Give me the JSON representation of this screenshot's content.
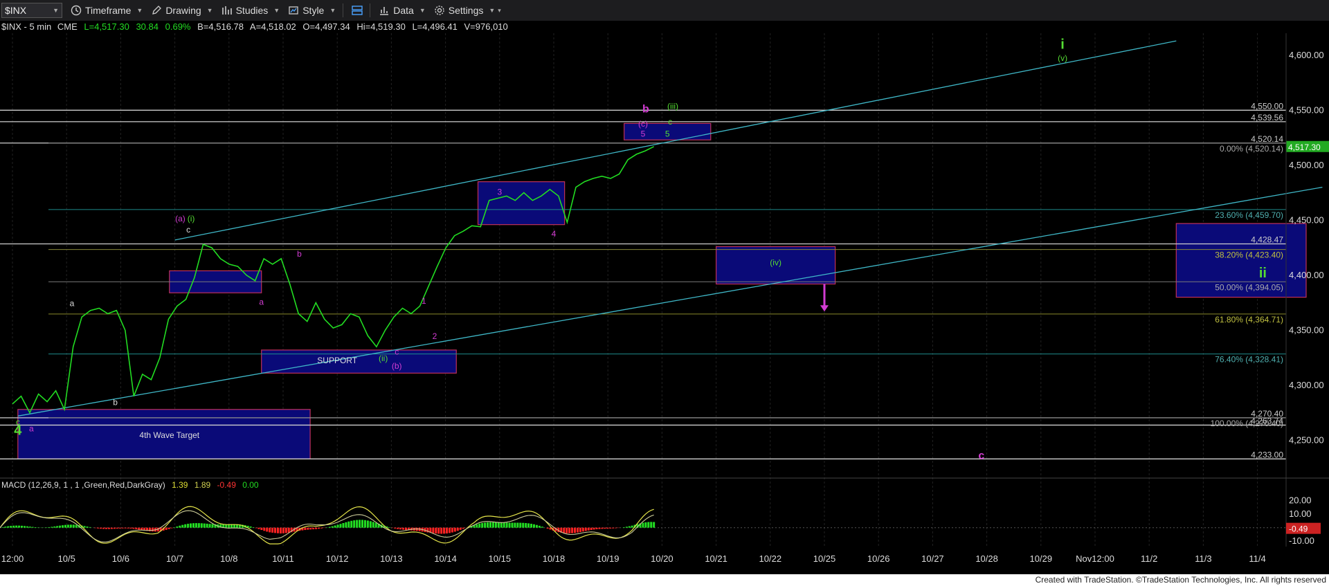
{
  "toolbar": {
    "symbol": "$INX",
    "timeframe": "Timeframe",
    "drawing": "Drawing",
    "studies": "Studies",
    "style": "Style",
    "data": "Data",
    "settings": "Settings"
  },
  "info_line": {
    "symbol": "$INX - 5 min",
    "exchange": "CME",
    "last": "L=4,517.30",
    "change": "30.84",
    "change_pct": "0.69%",
    "bid": "B=4,516.78",
    "ask": "A=4,518.02",
    "open": "O=4,497.34",
    "high": "Hi=4,519.30",
    "low": "L=4,496.41",
    "volume": "V=976,010"
  },
  "macd": {
    "label": "MACD (12,26,9, 1 , 1 ,Green,Red,DarkGray)",
    "v1": "1.39",
    "v2": "1.89",
    "v3": "-0.49",
    "v4": "0.00"
  },
  "footer": "Created with TradeStation. ©TradeStation Technologies, Inc. All rights reserved",
  "colors": {
    "price": "#22dd22",
    "channel": "#3fb8c8",
    "box_fill": "#0a0a78",
    "box_border": "#c0305a",
    "magenta": "#d23cd2",
    "green_label": "#55dd33",
    "white_label": "#dddddd"
  },
  "chart_data": {
    "type": "line",
    "title": "$INX - 5 min",
    "x": [
      "12:00",
      "10/5",
      "10/6",
      "10/7",
      "10/8",
      "10/11",
      "10/12",
      "10/13",
      "10/14",
      "10/15",
      "10/18",
      "10/19",
      "10/20",
      "10/21",
      "10/22",
      "10/25",
      "10/26",
      "10/27",
      "10/28",
      "10/29",
      "Nov12:00",
      "11/2",
      "11/3",
      "11/4"
    ],
    "ylim": [
      4220,
      4620
    ],
    "y_ticks": [
      "4,600.00",
      "4,550.00",
      "4,500.00",
      "4,450.00",
      "4,400.00",
      "4,350.00",
      "4,300.00",
      "4,250.00"
    ],
    "last_price": "4,517.30",
    "series": [
      {
        "values": [
          4283,
          4290,
          4275,
          4292,
          4285,
          4295,
          4278,
          4335,
          4362,
          4368,
          4370,
          4365,
          4368,
          4350,
          4290,
          4310,
          4305,
          4325,
          4360,
          4372,
          4378,
          4398,
          4428,
          4425,
          4415,
          4410,
          4408,
          4400,
          4395,
          4415,
          4410,
          4415,
          4392,
          4365,
          4358,
          4375,
          4360,
          4352,
          4355,
          4365,
          4362,
          4345,
          4335,
          4350,
          4362,
          4370,
          4365,
          4372,
          4390,
          4408,
          4425,
          4436,
          4440,
          4445,
          4444,
          4468,
          4470,
          4472,
          4468,
          4475,
          4468,
          4472,
          4478,
          4472,
          4448,
          4480,
          4485,
          4488,
          4490,
          4488,
          4492,
          4505,
          4510,
          4513,
          4517
        ]
      }
    ],
    "horizontal_levels": [
      {
        "label": "4,550.00",
        "value": 4550
      },
      {
        "label": "4,539.56",
        "value": 4539.56
      },
      {
        "label": "4,520.14",
        "value": 4520.14
      },
      {
        "label": "4,428.47",
        "value": 4428.47
      },
      {
        "label": "4,270.40",
        "value": 4270.4
      },
      {
        "label": "4,263.74",
        "value": 4263.74
      },
      {
        "label": "4,233.00",
        "value": 4233
      }
    ],
    "fib_levels": [
      {
        "label": "0.00% (4,520.14)",
        "value": 4520.14
      },
      {
        "label": "23.60% (4,459.70)",
        "value": 4459.7
      },
      {
        "label": "38.20% (4,423.40)",
        "value": 4423.4
      },
      {
        "label": "50.00% (4,394.05)",
        "value": 4394.05
      },
      {
        "label": "61.80% (4,364.71)",
        "value": 4364.71
      },
      {
        "label": "76.40% (4,328.41)",
        "value": 4328.41
      },
      {
        "label": "100.00% (4,270.40)",
        "value": 4270.4
      }
    ],
    "boxes": [
      {
        "label": "4th Wave Target",
        "x0": 0.1,
        "x1": 5.5,
        "y0": 4233,
        "y1": 4278
      },
      {
        "label": "",
        "x0": 2.9,
        "x1": 4.6,
        "y0": 4384,
        "y1": 4404
      },
      {
        "label": "SUPPORT",
        "x0": 4.6,
        "x1": 8.2,
        "y0": 4311,
        "y1": 4332
      },
      {
        "label": "",
        "x0": 8.6,
        "x1": 10.2,
        "y0": 4446,
        "y1": 4485
      },
      {
        "label": "",
        "x0": 11.3,
        "x1": 12.9,
        "y0": 4523,
        "y1": 4538
      },
      {
        "label": "(iv)",
        "x0": 13.0,
        "x1": 15.2,
        "y0": 4392,
        "y1": 4426
      },
      {
        "label": "ii",
        "x0": 21.5,
        "x1": 23.9,
        "y0": 4380,
        "y1": 4447
      }
    ],
    "channel_lines": [
      {
        "x0": 0.1,
        "y0": 4272,
        "x1": 24.2,
        "y1": 4480
      },
      {
        "x0": 3.0,
        "y0": 4432,
        "x1": 21.5,
        "y1": 4613
      }
    ],
    "annotations": [
      {
        "text": "c",
        "x": 0.1,
        "y": 4264,
        "color": "green"
      },
      {
        "text": "4",
        "x": 0.1,
        "y": 4255,
        "color": "green"
      },
      {
        "text": "a",
        "x": 0.35,
        "y": 4258,
        "color": "magenta"
      },
      {
        "text": "a",
        "x": 1.1,
        "y": 4372,
        "color": "white"
      },
      {
        "text": "b",
        "x": 1.9,
        "y": 4282,
        "color": "white"
      },
      {
        "text": "4th Wave Target",
        "x": 2.9,
        "y": 4252,
        "color": "white"
      },
      {
        "text": "(a)",
        "x": 3.1,
        "y": 4449,
        "color": "magenta"
      },
      {
        "text": "(i)",
        "x": 3.3,
        "y": 4449,
        "color": "green"
      },
      {
        "text": "c",
        "x": 3.25,
        "y": 4439,
        "color": "white"
      },
      {
        "text": "a",
        "x": 4.6,
        "y": 4373,
        "color": "magenta"
      },
      {
        "text": "b",
        "x": 5.3,
        "y": 4417,
        "color": "magenta"
      },
      {
        "text": "SUPPORT",
        "x": 6.0,
        "y": 4320,
        "color": "white"
      },
      {
        "text": "(ii)",
        "x": 6.85,
        "y": 4322,
        "color": "green"
      },
      {
        "text": "c",
        "x": 7.1,
        "y": 4328,
        "color": "magenta"
      },
      {
        "text": "(b)",
        "x": 7.1,
        "y": 4315,
        "color": "magenta"
      },
      {
        "text": "1",
        "x": 7.6,
        "y": 4374,
        "color": "magenta"
      },
      {
        "text": "2",
        "x": 7.8,
        "y": 4342,
        "color": "magenta"
      },
      {
        "text": "3",
        "x": 9.0,
        "y": 4473,
        "color": "magenta"
      },
      {
        "text": "4",
        "x": 10.0,
        "y": 4435,
        "color": "magenta"
      },
      {
        "text": "b",
        "x": 11.7,
        "y": 4548,
        "color": "magenta"
      },
      {
        "text": "(iii)",
        "x": 12.2,
        "y": 4551,
        "color": "green"
      },
      {
        "text": "(c)",
        "x": 11.65,
        "y": 4535,
        "color": "magenta"
      },
      {
        "text": "c",
        "x": 12.15,
        "y": 4537,
        "color": "green"
      },
      {
        "text": "5",
        "x": 11.65,
        "y": 4526,
        "color": "magenta"
      },
      {
        "text": "5",
        "x": 12.1,
        "y": 4526,
        "color": "green"
      },
      {
        "text": "(iv)",
        "x": 14.1,
        "y": 4409,
        "color": "green"
      },
      {
        "text": "i",
        "x": 19.4,
        "y": 4606,
        "color": "green"
      },
      {
        "text": "(v)",
        "x": 19.4,
        "y": 4595,
        "color": "green"
      },
      {
        "text": "ii",
        "x": 23.1,
        "y": 4398,
        "color": "green"
      },
      {
        "text": "c",
        "x": 17.9,
        "y": 4233,
        "color": "magenta"
      }
    ],
    "arrow": {
      "x": 15.0,
      "y_from": 4392,
      "y_to": 4367
    },
    "macd_ticks": [
      "20.00",
      "10.00",
      "0.00",
      "-10.00"
    ],
    "macd_current": "-0.49",
    "macd_ylim": [
      -14,
      26
    ]
  }
}
